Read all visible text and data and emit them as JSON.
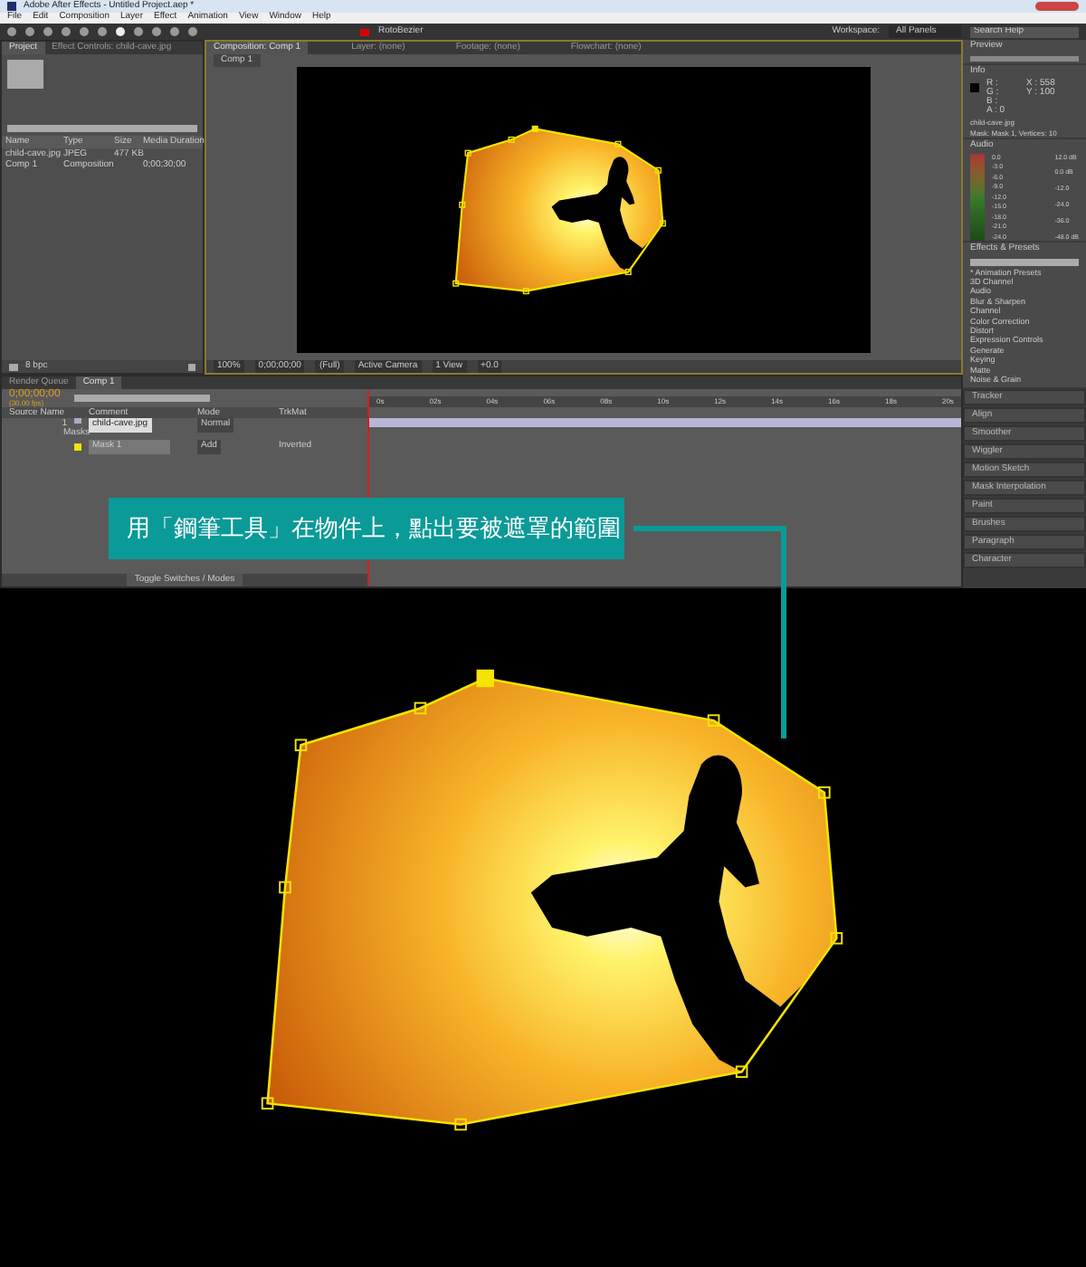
{
  "window": {
    "title": "Adobe After Effects - Untitled Project.aep *"
  },
  "menu": [
    "File",
    "Edit",
    "Composition",
    "Layer",
    "Effect",
    "Animation",
    "View",
    "Window",
    "Help"
  ],
  "toolbar": {
    "rotobezier": "RotoBezier",
    "workspace_label": "Workspace:",
    "workspace": "All Panels",
    "search": {
      "placeholder": "Search Help"
    }
  },
  "project_panel": {
    "tabs": [
      {
        "label": "Project",
        "selected": true
      },
      {
        "label": "Effect Controls: child-cave.jpg",
        "selected": false
      }
    ],
    "columns": [
      "Name",
      "Type",
      "Size",
      "Media Duration"
    ],
    "rows": [
      {
        "name": "child-cave.jpg",
        "type": "JPEG",
        "size": "477 KB",
        "duration": ""
      },
      {
        "name": "Comp 1",
        "type": "Composition",
        "size": "",
        "duration": "0;00;30;00"
      }
    ],
    "bpc": "8 bpc"
  },
  "composition_panel": {
    "tabs": [
      {
        "label": "Composition: Comp 1",
        "selected": true
      },
      {
        "label": "Layer: (none)",
        "selected": false
      },
      {
        "label": "Footage: (none)",
        "selected": false
      },
      {
        "label": "Flowchart: (none)",
        "selected": false
      }
    ],
    "breadcrumb": "Comp 1",
    "footer": [
      "100%",
      "0;00;00;00",
      "(Full)",
      "Active Camera",
      "1 View",
      "+0.0"
    ]
  },
  "right_panels": {
    "preview": "Preview",
    "info": {
      "title": "Info",
      "lines": [
        "R :",
        "G :",
        "B :",
        "A : 0"
      ],
      "coords": [
        "X : 558",
        "Y : 100"
      ],
      "file": "child-cave.jpg",
      "detail": "Mask: Mask 1, Vertices: 10"
    },
    "audio": {
      "title": "Audio",
      "left_scale": [
        "0.0",
        "-3.0",
        "-6.0",
        "-9.0",
        "-12.0",
        "-15.0",
        "-18.0",
        "-21.0",
        "-24.0"
      ],
      "right_scale": [
        "12.0 dB",
        "0.0 dB",
        "-12.0",
        "-24.0",
        "-36.0",
        "-48.0 dB"
      ]
    },
    "effects": {
      "title": "Effects & Presets",
      "items": [
        "* Animation Presets",
        "3D Channel",
        "Audio",
        "Blur & Sharpen",
        "Channel",
        "Color Correction",
        "Distort",
        "Expression Controls",
        "Generate",
        "Keying",
        "Matte",
        "Noise & Grain"
      ]
    },
    "collapsed": [
      "Tracker",
      "Align",
      "Smoother",
      "Wiggler",
      "Motion Sketch",
      "Mask Interpolation",
      "Paint",
      "Brushes",
      "Paragraph",
      "Character"
    ]
  },
  "timeline": {
    "tabs": [
      {
        "label": "Render Queue",
        "selected": false
      },
      {
        "label": "Comp 1",
        "selected": true
      }
    ],
    "time": "0;00;00;00",
    "fps": "(30.00 fps)",
    "columns": [
      "Source Name",
      "Comment",
      "Mode",
      "TrkMat"
    ],
    "ticks": [
      "0s",
      "02s",
      "04s",
      "06s",
      "08s",
      "10s",
      "12s",
      "14s",
      "16s",
      "18s",
      "20s"
    ],
    "layers": [
      {
        "index": "1",
        "name": "child-cave.jpg",
        "mode": "Normal",
        "masks_label": "Masks",
        "masks": [
          {
            "name": "Mask 1",
            "mode": "Add",
            "inverted": "Inverted"
          }
        ]
      }
    ],
    "footer": "Toggle Switches / Modes"
  },
  "callout": "用「鋼筆工具」在物件上，點出要被遮罩的範圍"
}
